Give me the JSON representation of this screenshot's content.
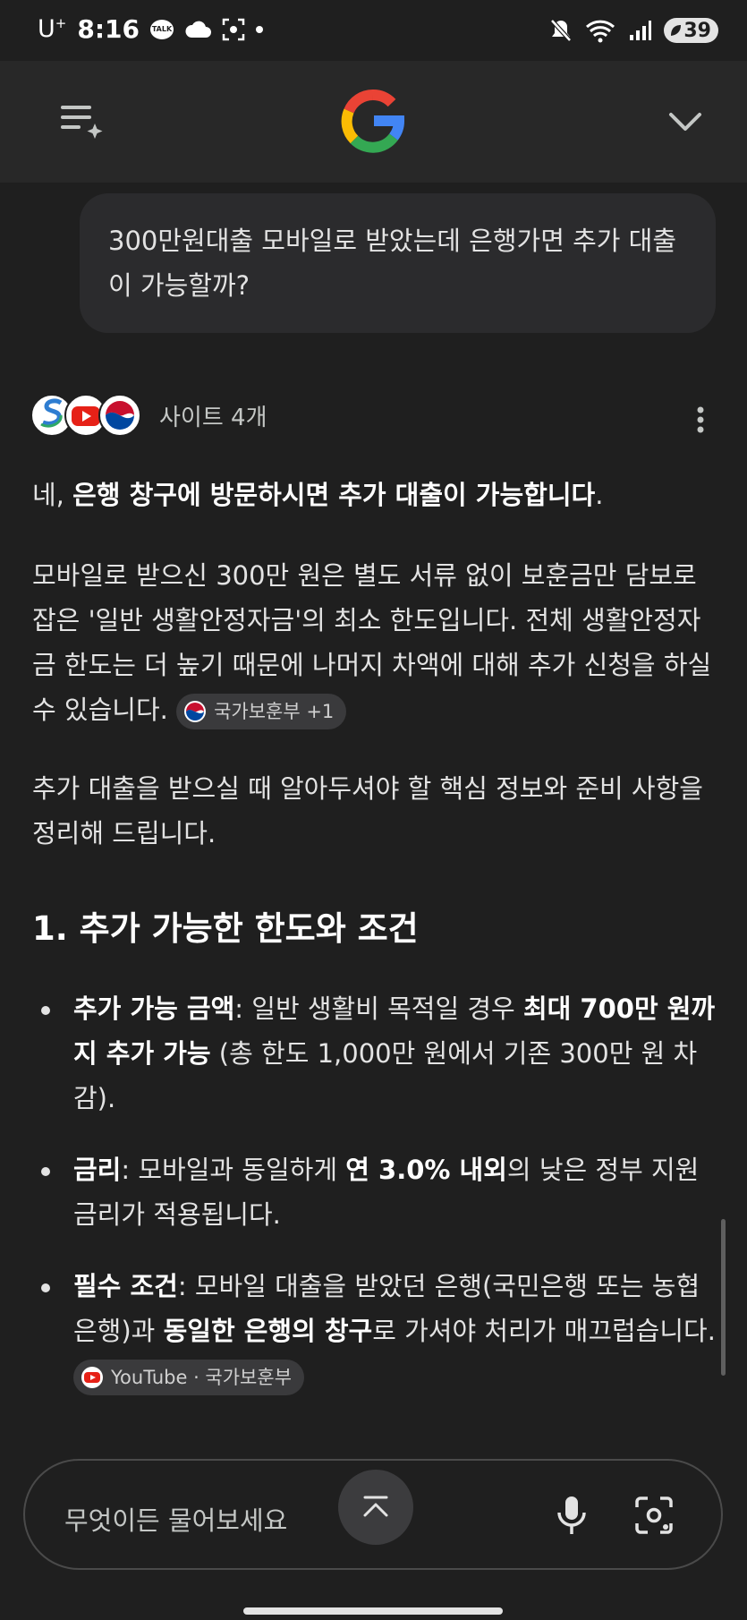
{
  "status": {
    "carrier": "U",
    "carrier_sup": "+",
    "time": "8:16",
    "talk": "TALK",
    "battery": "39"
  },
  "query": "300만원대출 모바일로 받았는데 은행가면 추가 대출이 가능할까?",
  "sources": {
    "label": "사이트 4개"
  },
  "answer": {
    "intro_pre": "네, ",
    "intro_bold": "은행 창구에 방문하시면 추가 대출이 가능합니다",
    "intro_post": ".",
    "para1": "모바일로 받으신 300만 원은 별도 서류 없이 보훈금만 담보로 잡은 '일반 생활안정자금'의 최소 한도입니다. 전체 생활안정자금 한도는 더 높기 때문에 나머지 차액에 대해 추가 신청을 하실 수 있습니다.",
    "chip1": "국가보훈부 +1",
    "para2": "추가 대출을 받으실 때 알아두셔야 할 핵심 정보와 준비 사항을 정리해 드립니다.",
    "heading1": "1. 추가 가능한 한도와 조건",
    "bullets": [
      {
        "b1": "추가 가능 금액",
        "t1": ": 일반 생활비 목적일 경우 ",
        "b2": "최대 700만 원까지 추가 가능",
        "t2": " (총 한도 1,000만 원에서 기존 300만 원 차감)."
      },
      {
        "b1": "금리",
        "t1": ": 모바일과 동일하게 ",
        "b2": "연 3.0% 내외",
        "t2": "의 낮은 정부 지원 금리가 적용됩니다."
      },
      {
        "b1": "필수 조건",
        "t1": ": 모바일 대출을 받았던 은행(국민은행 또는 농협은행)과 ",
        "b2": "동일한 은행의 창구",
        "t2": "로 가셔야 처리가 매끄럽습니다."
      }
    ],
    "chip2": "YouTube · 국가보훈부"
  },
  "input": {
    "placeholder": "무엇이든 물어보세요"
  },
  "colors": {
    "background": "#1f1f1f",
    "appbar": "#282828",
    "bubble": "#2b2b2d",
    "chip": "#3a3a3c",
    "youtube": "#e62117"
  }
}
